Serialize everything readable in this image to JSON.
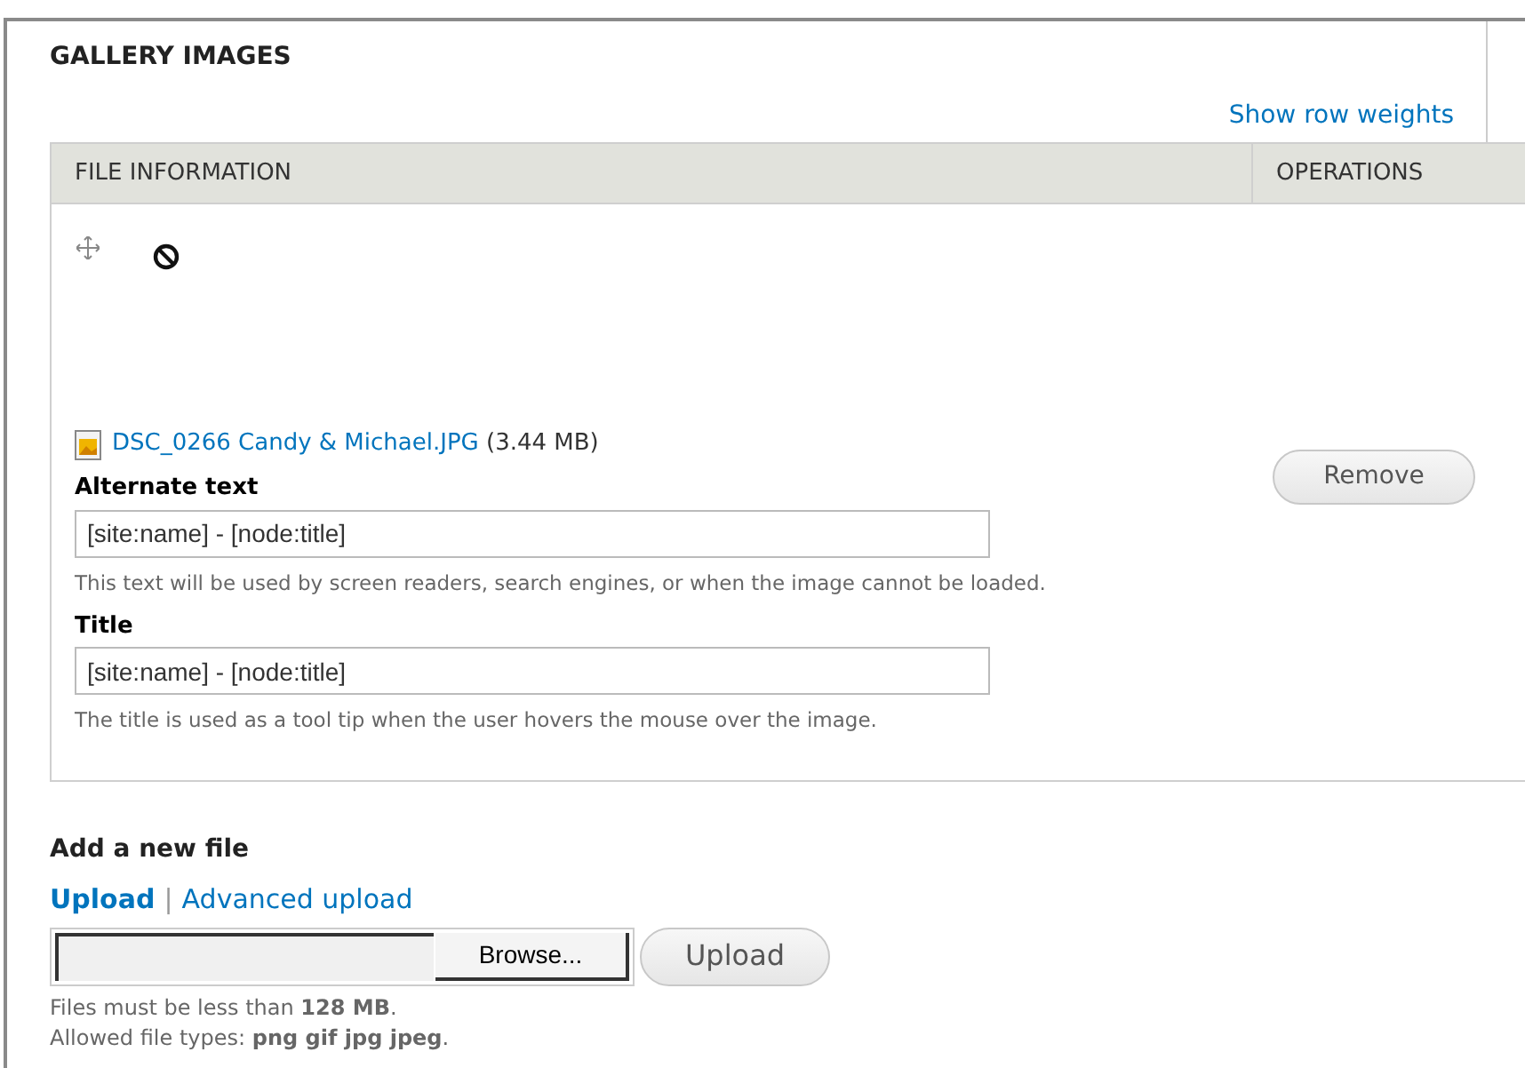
{
  "fieldset": {
    "legend": "GALLERY IMAGES"
  },
  "row_weights_link": "Show row weights",
  "table": {
    "columns": [
      "FILE INFORMATION",
      "OPERATIONS"
    ],
    "rows": [
      {
        "file": {
          "name": "DSC_0266 Candy & Michael.JPG",
          "size": "(3.44 MB)"
        },
        "fields": [
          {
            "label": "Alternate text",
            "value": "[site:name] - [node:title]",
            "help": "This text will be used by screen readers, search engines, or when the image cannot be loaded."
          },
          {
            "label": "Title",
            "value": "[site:name] - [node:title]",
            "help": "The title is used as a tool tip when the user hovers the mouse over the image."
          }
        ],
        "operation": "Remove"
      }
    ]
  },
  "add_file": {
    "heading": "Add a new file",
    "tabs": [
      {
        "label": "Upload",
        "selected": true
      },
      {
        "label": "Advanced upload",
        "selected": false
      }
    ],
    "separator": "|",
    "browse_button": "Browse...",
    "upload_button": "Upload",
    "help": [
      "Files must be less than **128 MB**.",
      "Allowed file types: **png gif jpg jpeg**."
    ]
  }
}
